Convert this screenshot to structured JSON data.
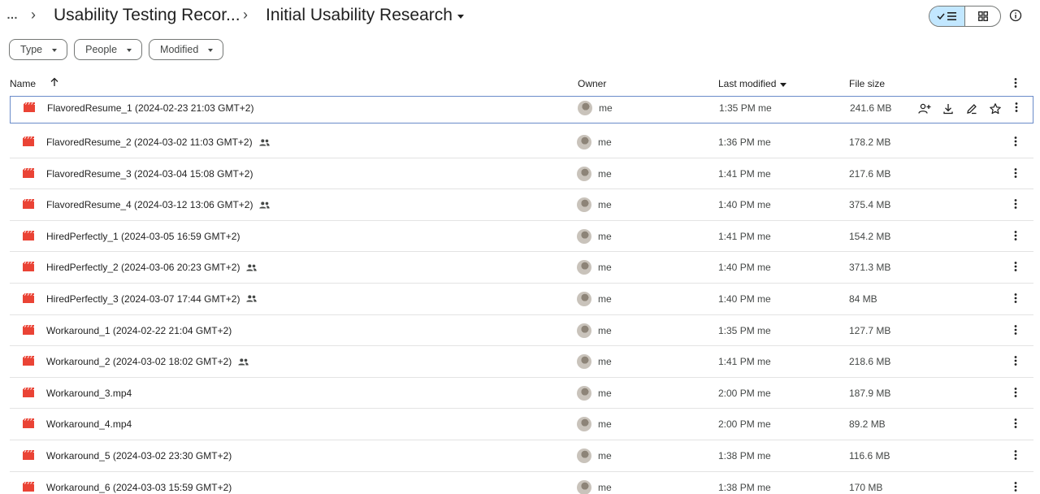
{
  "breadcrumb": {
    "more": "…",
    "parent": "Usability Testing Recor...",
    "current": "Initial Usability Research"
  },
  "filters": [
    {
      "label": "Type"
    },
    {
      "label": "People"
    },
    {
      "label": "Modified"
    }
  ],
  "columns": {
    "name": "Name",
    "owner": "Owner",
    "last_modified": "Last modified",
    "file_size": "File size"
  },
  "files": [
    {
      "name": "FlavoredResume_1 (2024-02-23 21:03 GMT+2)",
      "shared": false,
      "owner": "me",
      "modified": "1:35 PM me",
      "size": "241.6 MB",
      "selected": true
    },
    {
      "name": "FlavoredResume_2 (2024-03-02 11:03 GMT+2)",
      "shared": true,
      "owner": "me",
      "modified": "1:36 PM me",
      "size": "178.2 MB"
    },
    {
      "name": "FlavoredResume_3 (2024-03-04 15:08 GMT+2)",
      "shared": false,
      "owner": "me",
      "modified": "1:41 PM me",
      "size": "217.6 MB"
    },
    {
      "name": "FlavoredResume_4 (2024-03-12 13:06 GMT+2)",
      "shared": true,
      "owner": "me",
      "modified": "1:40 PM me",
      "size": "375.4 MB"
    },
    {
      "name": "HiredPerfectly_1 (2024-03-05 16:59 GMT+2)",
      "shared": false,
      "owner": "me",
      "modified": "1:41 PM me",
      "size": "154.2 MB"
    },
    {
      "name": "HiredPerfectly_2 (2024-03-06 20:23 GMT+2)",
      "shared": true,
      "owner": "me",
      "modified": "1:40 PM me",
      "size": "371.3 MB"
    },
    {
      "name": "HiredPerfectly_3 (2024-03-07 17:44 GMT+2)",
      "shared": true,
      "owner": "me",
      "modified": "1:40 PM me",
      "size": "84 MB"
    },
    {
      "name": "Workaround_1 (2024-02-22 21:04 GMT+2)",
      "shared": false,
      "owner": "me",
      "modified": "1:35 PM me",
      "size": "127.7 MB"
    },
    {
      "name": "Workaround_2 (2024-03-02 18:02 GMT+2)",
      "shared": true,
      "owner": "me",
      "modified": "1:41 PM me",
      "size": "218.6 MB"
    },
    {
      "name": "Workaround_3.mp4",
      "shared": false,
      "owner": "me",
      "modified": "2:00 PM me",
      "size": "187.9 MB"
    },
    {
      "name": "Workaround_4.mp4",
      "shared": false,
      "owner": "me",
      "modified": "2:00 PM me",
      "size": "89.2 MB"
    },
    {
      "name": "Workaround_5 (2024-03-02 23:30 GMT+2)",
      "shared": false,
      "owner": "me",
      "modified": "1:38 PM me",
      "size": "116.6 MB"
    },
    {
      "name": "Workaround_6 (2024-03-03 15:59 GMT+2)",
      "shared": false,
      "owner": "me",
      "modified": "1:38 PM me",
      "size": "170 MB"
    }
  ],
  "colors": {
    "video_icon": "#ea4335",
    "view_toggle_active": "#c2e7ff",
    "selected_border": "#6a8bc9"
  }
}
